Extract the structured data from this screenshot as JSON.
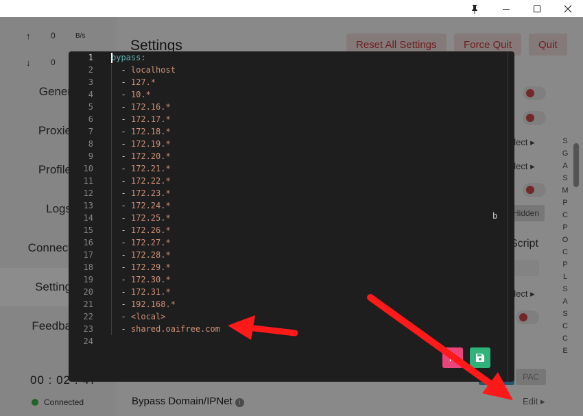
{
  "titlebar": {
    "pin_icon": "pin-icon",
    "minimize_icon": "minimize-icon",
    "maximize_icon": "maximize-icon",
    "close_icon": "close-icon"
  },
  "traffic": {
    "up": {
      "arrow": "↑",
      "value": "0",
      "unit": "B/s"
    },
    "down": {
      "arrow": "↓",
      "value": "0"
    }
  },
  "sidebar": {
    "items": [
      {
        "label": "Gener"
      },
      {
        "label": "Proxie"
      },
      {
        "label": "Profile"
      },
      {
        "label": "Logs"
      },
      {
        "label": "Connect"
      },
      {
        "label": "Setting"
      },
      {
        "label": "Feedba"
      }
    ],
    "timer": "00 : 02 : 47",
    "status": "Connected",
    "status_color": "#39b54a"
  },
  "main": {
    "title": "Settings",
    "reset_label": "Reset All Settings",
    "force_quit_label": "Force Quit",
    "quit_label": "Quit",
    "select_1": "elect ▸",
    "select_2": "elect ▸",
    "select_3": "elect ▸",
    "hidden_label": "Hidden",
    "script_label": "Script",
    "pac_label": "PAC",
    "bypass_label": "Bypass Domain/IPNet",
    "info_icon": "i",
    "edit_label": "Edit ▸",
    "index_letters": [
      "S",
      "G",
      "A",
      "S",
      "M",
      "P",
      "C",
      "P",
      "O",
      "C",
      "P",
      "L",
      "S",
      "A",
      "S",
      "C",
      "C",
      "E"
    ]
  },
  "editor": {
    "lines": [
      {
        "n": "1",
        "key": "bypass:"
      },
      {
        "n": "2",
        "val": "localhost"
      },
      {
        "n": "3",
        "val": "127.*"
      },
      {
        "n": "4",
        "val": "10.*"
      },
      {
        "n": "5",
        "val": "172.16.*"
      },
      {
        "n": "6",
        "val": "172.17.*"
      },
      {
        "n": "7",
        "val": "172.18.*"
      },
      {
        "n": "8",
        "val": "172.19.*"
      },
      {
        "n": "9",
        "val": "172.20.*"
      },
      {
        "n": "10",
        "val": "172.21.*"
      },
      {
        "n": "11",
        "val": "172.22.*"
      },
      {
        "n": "12",
        "val": "172.23.*"
      },
      {
        "n": "13",
        "val": "172.24.*"
      },
      {
        "n": "14",
        "val": "172.25.*"
      },
      {
        "n": "15",
        "val": "172.26.*"
      },
      {
        "n": "16",
        "val": "172.27.*"
      },
      {
        "n": "17",
        "val": "172.28.*"
      },
      {
        "n": "18",
        "val": "172.29.*"
      },
      {
        "n": "19",
        "val": "172.30.*"
      },
      {
        "n": "20",
        "val": "172.31.*"
      },
      {
        "n": "21",
        "val": "192.168.*"
      },
      {
        "n": "22",
        "val": "<local>"
      },
      {
        "n": "23",
        "val": "shared.oaifree.com"
      },
      {
        "n": "24"
      }
    ],
    "stray_char": "b",
    "cancel_icon": "✗",
    "save_icon": "save-icon",
    "cancel_color": "#e9457d",
    "save_color": "#2fb37a"
  },
  "annotation_color": "#ff1a1a"
}
